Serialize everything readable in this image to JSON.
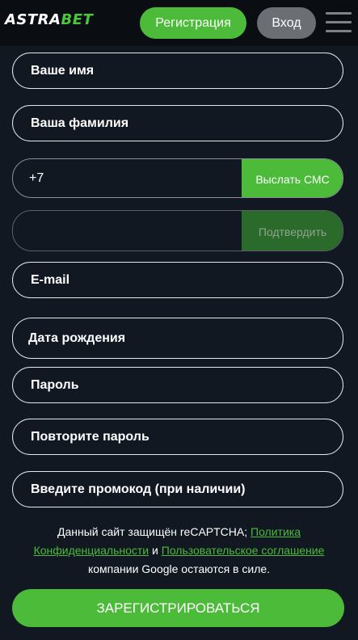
{
  "header": {
    "logo_left": "ASTRA",
    "logo_right": "BET",
    "register_label": "Регистрация",
    "login_label": "Вход"
  },
  "form": {
    "first_name": "Ваше имя",
    "last_name": "Ваша фамилия",
    "phone_value": "+7",
    "send_sms_label": "Выслать СМС",
    "code_value": "",
    "confirm_label": "Подтвердить",
    "email": "E-mail",
    "birth_date": "Дата рождения",
    "password": "Пароль",
    "repeat_password": "Повторите пароль",
    "promo": "Введите промокод (при наличии)"
  },
  "notice": {
    "text_1": "Данный сайт защищён reCAPTCHA; ",
    "privacy_link": "Политика Конфиденциальности",
    "text_2": " и ",
    "terms_link": "Пользовательское соглашение",
    "text_3": " компании Google остаются в силе."
  },
  "submit_label": "ЗАРЕГИСТРИРОВАТЬСЯ",
  "colors": {
    "background": "#111822",
    "accent": "#4cbb3a",
    "login_button": "#6b6f74"
  }
}
